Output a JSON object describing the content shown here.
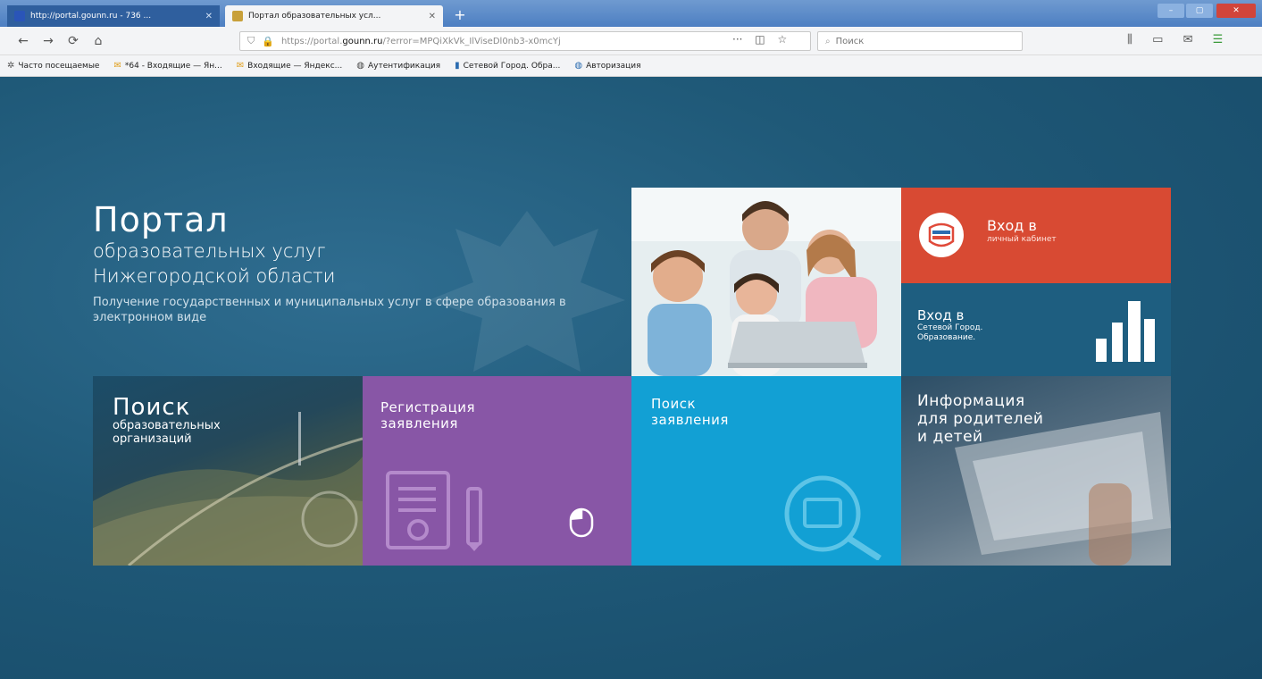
{
  "browser": {
    "tabs": [
      {
        "title": "http://portal.gounn.ru - 736 ...",
        "active": false
      },
      {
        "title": "Портал образовательных усл...",
        "active": true
      }
    ],
    "url": {
      "prefix": "https://portal.",
      "domain": "gounn.ru",
      "rest": "/?error=MPQiXkVk_IlViseDl0nb3-x0mcYj"
    },
    "search_placeholder": "Поиск",
    "bookmarks": [
      {
        "label": "Часто посещаемые",
        "icon": "gear-icon"
      },
      {
        "label": "*64 - Входящие — Ян...",
        "icon": "mail-icon"
      },
      {
        "label": "Входящие — Яндекс...",
        "icon": "mail-icon"
      },
      {
        "label": "Аутентификация",
        "icon": "globe-icon"
      },
      {
        "label": "Сетевой Город. Обра...",
        "icon": "chart-icon"
      },
      {
        "label": "Авторизация",
        "icon": "globe-icon"
      }
    ]
  },
  "hero": {
    "title": "Портал",
    "subtitle_1": "образовательных услуг",
    "subtitle_2": "Нижегородской области",
    "description": "Получение государственных и муниципальных услуг в сфере образования в электронном виде"
  },
  "tiles": {
    "gos": {
      "line1": "Вход в",
      "line2": "личный кабинет",
      "color": "#d84a33"
    },
    "sgo": {
      "line1": "Вход в",
      "line2": "Сетевой Город.",
      "line3": "Образование.",
      "color": "#1e5e80"
    },
    "search_org": {
      "big": "Поиск",
      "small_1": "образовательных",
      "small_2": "организаций"
    },
    "registration": {
      "line1": "Регистрация",
      "line2": "заявления",
      "color": "#8856a6"
    },
    "find": {
      "line1": "Поиск",
      "line2": "заявления",
      "color": "#12a0d4"
    },
    "info": {
      "line1": "Информация",
      "line2": "для родителей",
      "line3": "и детей"
    }
  },
  "colors": {
    "page_bg": "#1f5978",
    "accent": "#12a0d4"
  }
}
